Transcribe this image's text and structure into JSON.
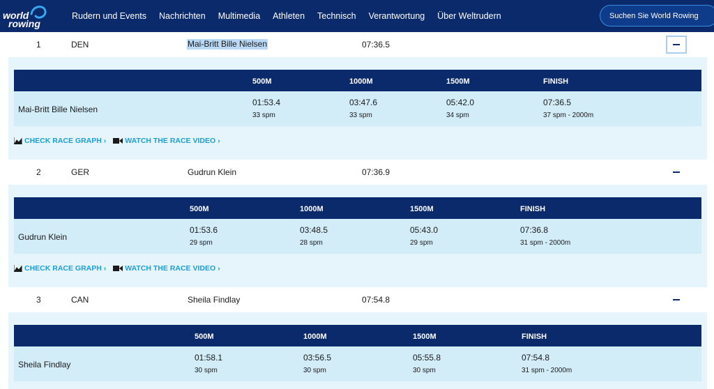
{
  "header": {
    "logo_line1": "world",
    "logo_line2": "rowing",
    "nav": [
      "Rudern und Events",
      "Nachrichten",
      "Multimedia",
      "Athleten",
      "Technisch",
      "Verantwortung",
      "Über Weltrudern"
    ],
    "search_placeholder": "Suchen Sie World Rowing"
  },
  "colors": {
    "brand": "#0b2a6b",
    "link": "#1aa0d8",
    "panel": "#e6f4fb",
    "split_row": "#d2ecf8"
  },
  "labels": {
    "check_graph": "CHECK RACE GRAPH ›",
    "watch_video": "WATCH THE RACE VIDEO ›"
  },
  "results": [
    {
      "rank": "1",
      "country": "DEN",
      "athlete": "Mai-Britt Bille Nielsen",
      "time": "07:36.5",
      "split_headers": [
        "500M",
        "1000M",
        "1500M",
        "FINISH"
      ],
      "splits": [
        {
          "time": "01:53.4",
          "spm": "33 spm"
        },
        {
          "time": "03:47.6",
          "spm": "33 spm"
        },
        {
          "time": "05:42.0",
          "spm": "34 spm"
        },
        {
          "time": "07:36.5",
          "spm": "37 spm - 2000m"
        }
      ]
    },
    {
      "rank": "2",
      "country": "GER",
      "athlete": "Gudrun Klein",
      "time": "07:36.9",
      "split_headers": [
        "500M",
        "1000M",
        "1500M",
        "FINISH"
      ],
      "splits": [
        {
          "time": "01:53.6",
          "spm": "29 spm"
        },
        {
          "time": "03:48.5",
          "spm": "28 spm"
        },
        {
          "time": "05:43.0",
          "spm": "29 spm"
        },
        {
          "time": "07:36.8",
          "spm": "31 spm - 2000m"
        }
      ]
    },
    {
      "rank": "3",
      "country": "CAN",
      "athlete": "Sheila Findlay",
      "time": "07:54.8",
      "split_headers": [
        "500M",
        "1000M",
        "1500M",
        "FINISH"
      ],
      "splits": [
        {
          "time": "01:58.1",
          "spm": "30 spm"
        },
        {
          "time": "03:56.5",
          "spm": "30 spm"
        },
        {
          "time": "05:55.8",
          "spm": "30 spm"
        },
        {
          "time": "07:54.8",
          "spm": "31 spm - 2000m"
        }
      ]
    }
  ]
}
